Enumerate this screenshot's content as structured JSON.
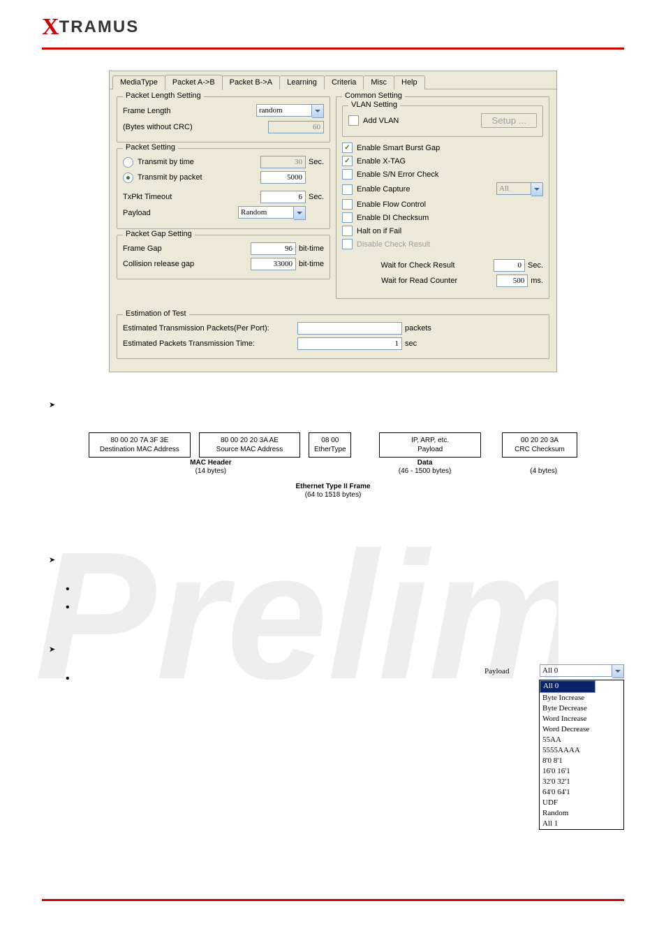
{
  "brand": {
    "x": "X",
    "rest": "TRAMUS"
  },
  "tabs": [
    "MediaType",
    "Packet A->B",
    "Packet B->A",
    "Learning",
    "Criteria",
    "Misc",
    "Help"
  ],
  "activeTab": 1,
  "pkt_len": {
    "legend": "Packet Length Setting",
    "frame_len_lbl": "Frame Length",
    "frame_len_val": "random",
    "bytes_lbl": "(Bytes without CRC)",
    "bytes_val": "60"
  },
  "pkt_set": {
    "legend": "Packet Setting",
    "by_time": "Transmit by time",
    "by_time_val": "30",
    "by_time_unit": "Sec.",
    "by_pkt": "Transmit by packet",
    "by_pkt_val": "5000",
    "timeout": "TxPkt Timeout",
    "timeout_val": "6",
    "timeout_unit": "Sec.",
    "payload": "Payload",
    "payload_val": "Random"
  },
  "gap": {
    "legend": "Packet Gap Setting",
    "frame": "Frame Gap",
    "frame_val": "96",
    "u1": "bit-time",
    "coll": "Collision release gap",
    "coll_val": "33000",
    "u2": "bit-time"
  },
  "est": {
    "legend": "Estimation of Test",
    "pp": "Estimated Transmission Packets(Per Port):",
    "pp_val": "",
    "pp_u": "packets",
    "tt": "Estimated Packets Transmission Time:",
    "tt_val": "1",
    "tt_u": "sec"
  },
  "common": {
    "legend": "Common Setting"
  },
  "vlan": {
    "legend": "VLAN Setting",
    "add": "Add VLAN",
    "setup": "Setup ..."
  },
  "opts": {
    "sbg": "Enable Smart Burst Gap",
    "xtag": "Enable X-TAG",
    "sn": "Enable S/N Error Check",
    "cap": "Enable Capture",
    "cap_sel": "All",
    "fc": "Enable Flow Control",
    "di": "Enable DI Checksum",
    "halt": "Halt on if Fail",
    "dcr": "Disable Check Result"
  },
  "wait": {
    "chk": "Wait for Check Result",
    "chk_val": "0",
    "chk_u": "Sec.",
    "rc": "Wait for Read Counter",
    "rc_val": "500",
    "rc_u": "ms."
  },
  "frame": {
    "da": "80 00 20 7A 3F 3E",
    "da2": "Destination MAC Address",
    "sa": "80 00 20 20 3A AE",
    "sa2": "Source MAC Address",
    "et": "08 00",
    "et2": "EtherType",
    "pl": "IP, ARP, etc.",
    "pl2": "Payload",
    "crc": "00 20 20 3A",
    "crc2": "CRC Checksum",
    "mac": "MAC Header",
    "mac2": "(14 bytes)",
    "data": "Data",
    "data2": "(46 - 1500 bytes)",
    "data3": "(4 bytes)",
    "title": "Ethernet Type II Frame",
    "title2": "(64 to 1518 bytes)"
  },
  "combo": {
    "lbl": "Payload",
    "val": "All 0",
    "options": [
      "All 0",
      "Byte Increase",
      "Byte Decrease",
      "Word Increase",
      "Word Decrease",
      "55AA",
      "5555AAAA",
      "8'0 8'1",
      "16'0 16'1",
      "32'0 32'1",
      "64'0 64'1",
      "UDF",
      "Random",
      "All 1"
    ]
  }
}
